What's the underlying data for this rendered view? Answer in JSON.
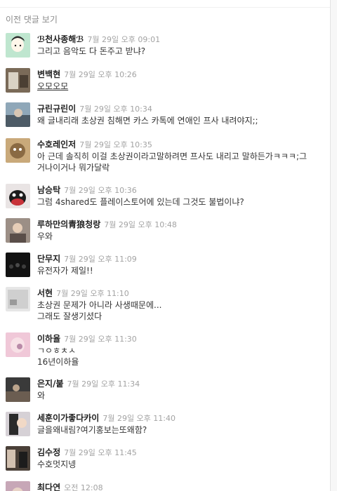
{
  "header": {
    "prev_comments_label": "이전 댓글 보기"
  },
  "comments": [
    {
      "name": "ℬ천사종해ℬ",
      "time": "7월 29일 오후 09:01",
      "lines": [
        "그리고 음악도 다 돈주고 받냐?"
      ]
    },
    {
      "name": "변백현",
      "time": "7월 29일 오후 10:26",
      "lines": [
        "오모오모"
      ],
      "underline": true
    },
    {
      "name": "규린규린이",
      "time": "7월 29일 오후 10:34",
      "lines": [
        "왜 글내리래 초상권 침해면 카스 카톡에 연애인 프사 내려야지;;"
      ]
    },
    {
      "name": "수호레인저",
      "time": "7월 29일 오후 10:35",
      "lines": [
        "아 근데 솔직히 이걸 초상권이라고말하려면 프사도 내리고 말하든가ㅋㅋㅋ;그",
        "거나이거나 뭐가달락"
      ]
    },
    {
      "name": "남승탁",
      "time": "7월 29일 오후 10:36",
      "lines": [
        "그럼 4shared도 플레이스토어에 있는데 그것도 불법이냐?"
      ]
    },
    {
      "name": "루하만의青狼청랑",
      "time": "7월 29일 오후 10:48",
      "lines": [
        "우와"
      ]
    },
    {
      "name": "단무지",
      "time": "7월 29일 오후 11:09",
      "lines": [
        "유전자가 제일!!"
      ]
    },
    {
      "name": "서현",
      "time": "7월 29일 오후 11:10",
      "lines": [
        "초상권 문제가 아니라 사생때문에...",
        "그래도 잘생기셨다"
      ]
    },
    {
      "name": "이하율",
      "time": "7월 29일 오후 11:30",
      "lines": [
        "ㄱㅇㅎㅊㅅ",
        "16년이하율"
      ]
    },
    {
      "name": "은지/붙",
      "time": "7월 29일 오후 11:34",
      "lines": [
        "와"
      ]
    },
    {
      "name": "세훈이가좋다카이",
      "time": "7월 29일 오후 11:40",
      "lines": [
        "글을왜내림?여기홍보는또왜함?"
      ]
    },
    {
      "name": "김수정",
      "time": "7월 29일 오후 11:45",
      "lines": [
        "수호멋지넹"
      ]
    },
    {
      "name": "최다연",
      "time": "오전 12:08",
      "lines": []
    }
  ],
  "avatar_icons": [
    "cartoon-boy-avatar-icon",
    "photo-avatar-icon",
    "photo-avatar-icon",
    "cartoon-face-avatar-icon",
    "penguin-avatar-icon",
    "photo-avatar-icon",
    "dark-group-photo-avatar-icon",
    "photo-avatar-icon",
    "photo-avatar-icon",
    "photo-avatar-icon",
    "photo-avatar-icon",
    "photo-avatar-icon",
    "photo-avatar-icon"
  ],
  "colors": {
    "name": "#222222",
    "time": "#a3a3a3",
    "text": "#333333",
    "link": "#8b8b8b"
  }
}
